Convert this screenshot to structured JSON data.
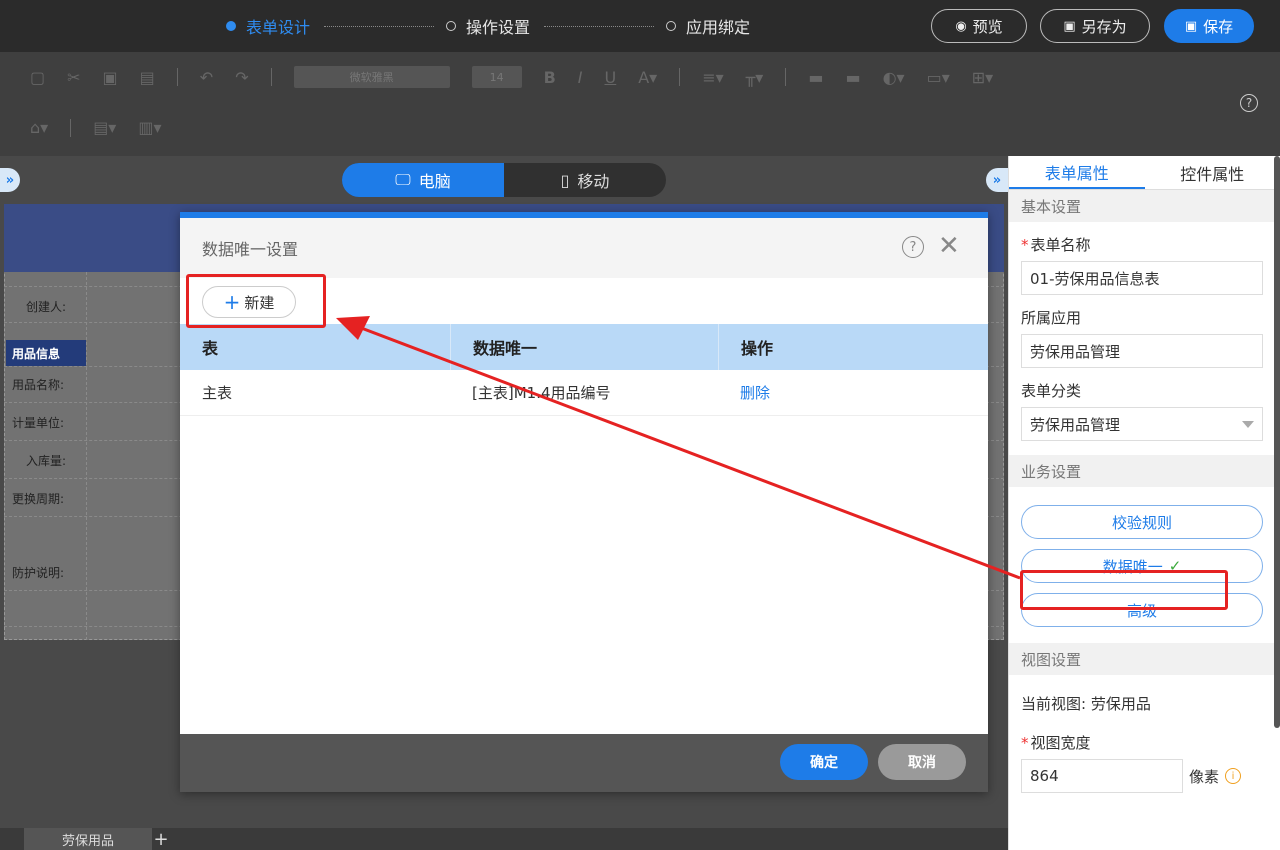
{
  "topbar": {
    "steps": [
      {
        "label": "表单设计",
        "active": true
      },
      {
        "label": "操作设置",
        "active": false
      },
      {
        "label": "应用绑定",
        "active": false
      }
    ],
    "preview_label": "预览",
    "save_as_label": "另存为",
    "save_label": "保存"
  },
  "toolbar": {
    "font_name": "微软雅黑",
    "font_size": "14",
    "help_icon": "question-circle-icon"
  },
  "canvas": {
    "view_desktop": "电脑",
    "view_mobile": "移动",
    "form_labels": [
      "创建人:",
      "用品名称:",
      "计量单位:",
      "入库量:",
      "更换周期:",
      "防护说明:"
    ],
    "section_label": "用品信息"
  },
  "sheet_tabs": {
    "tab": "劳保用品",
    "add": "+"
  },
  "right_panel": {
    "tabs": [
      "表单属性",
      "控件属性"
    ],
    "basic_section": "基本设置",
    "form_name_label": "表单名称",
    "form_name_value": "01-劳保用品信息表",
    "app_label": "所属应用",
    "app_value": "劳保用品管理",
    "category_label": "表单分类",
    "category_value": "劳保用品管理",
    "business_section": "业务设置",
    "validate_button": "校验规则",
    "unique_button": "数据唯一",
    "advanced_button": "高级",
    "view_section": "视图设置",
    "current_view_label": "当前视图:",
    "current_view_value": "劳保用品",
    "view_width_label": "视图宽度",
    "view_width_value": "864",
    "view_width_unit": "像素"
  },
  "modal": {
    "title": "数据唯一设置",
    "new_button": "新建",
    "columns": [
      "表",
      "数据唯一",
      "操作"
    ],
    "rows": [
      {
        "table": "主表",
        "unique": "[主表]M1.4用品编号",
        "action": "删除"
      }
    ],
    "ok_button": "确定",
    "cancel_button": "取消"
  },
  "colors": {
    "accent": "#1e7ce8",
    "annotation": "#e52222",
    "check": "#3caa3c"
  }
}
